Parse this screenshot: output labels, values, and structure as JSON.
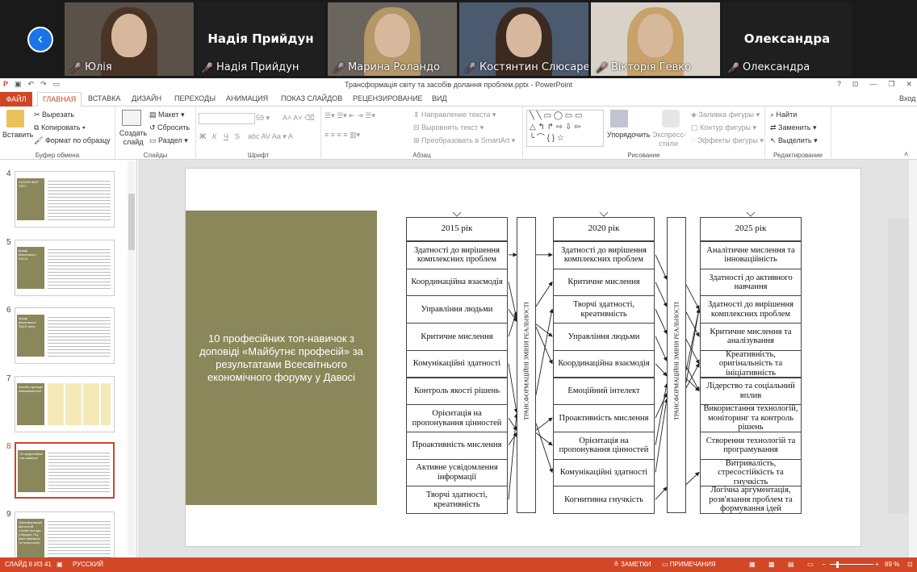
{
  "videocall": {
    "participants": [
      {
        "caption": "Юлія",
        "type": "video"
      },
      {
        "caption": "Надія Прийдун",
        "type": "name",
        "big_name": "Надія Прийдун"
      },
      {
        "caption": "Марина Роландо",
        "type": "video"
      },
      {
        "caption": "Костянтин Слюсарен...",
        "type": "video"
      },
      {
        "caption": "Вікторія Гевко",
        "type": "video"
      },
      {
        "caption": "Олександра",
        "type": "name",
        "big_name": "Олександра"
      }
    ]
  },
  "app": {
    "title": "Трансформація світу та засобів долання проблем.pptx - PowerPoint",
    "help": "?",
    "signin": "Вход"
  },
  "ribbon_tabs": [
    "ФАЙЛ",
    "ГЛАВНАЯ",
    "ВСТАВКА",
    "ДИЗАЙН",
    "ПЕРЕХОДЫ",
    "АНИМАЦИЯ",
    "ПОКАЗ СЛАЙДОВ",
    "РЕЦЕНЗИРОВАНИЕ",
    "ВИД"
  ],
  "ribbon": {
    "clipboard": {
      "paste": "Вставить",
      "cut": "Вырезать",
      "copy": "Копировать",
      "format": "Формат по образцу",
      "label": "Буфер обмена"
    },
    "slides": {
      "new": "Создать слайд",
      "layout": "Макет",
      "reset": "Сбросить",
      "section": "Раздел",
      "label": "Слайды"
    },
    "font": {
      "size": "59",
      "label": "Шрифт",
      "bold": "Ж",
      "italic": "К",
      "underline": "Ч",
      "shadow": "S"
    },
    "paragraph": {
      "direction": "Направление текста",
      "align": "Выровнять текст",
      "smartart": "Преобразовать в SmartArt",
      "label": "Абзац"
    },
    "drawing": {
      "arrange": "Упорядочить",
      "quick": "Экспресс-стили",
      "fill": "Заливка фигуры",
      "outline": "Контур фигуры",
      "effects": "Эффекты фигуры",
      "label": "Рисование"
    },
    "editing": {
      "find": "Найти",
      "replace": "Заменить",
      "select": "Выделить",
      "label": "Редактирование"
    }
  },
  "thumbnails": [
    {
      "num": "4",
      "text": "VUCA В ЖИТ ТЕРІ"
    },
    {
      "num": "5",
      "text": "Кращі властивості VUCA"
    },
    {
      "num": "6",
      "text": "Кращі властивості SAVE світу"
    },
    {
      "num": "7",
      "text": "Засоби протидії невизначеності"
    },
    {
      "num": "8",
      "text": "10 професійних топ-навичок"
    },
    {
      "num": "9",
      "text": "Трансформація цінностей: головні тренди (гібридні, ПЦ, рівні навчання та технологій)"
    }
  ],
  "slide": {
    "title": "10 професійних топ-навичок з доповіді «Майбутнє професій» за результатами Всесвітнього економічного форуму у Давосі",
    "columns": [
      {
        "header": "2015 рік",
        "items": [
          "Здатності до вирішення комплексних проблем",
          "Координаційна взаємодія",
          "Управління людьми",
          "Критичне мислення",
          "Комунікаційні здатності",
          "Контроль якості рішень",
          "Орієнтація на пропонування цінностей",
          "Проактивність мислення",
          "Активне усвідомлення інформації",
          "Творчі здатності, креативність"
        ]
      },
      {
        "header": "2020 рік",
        "items": [
          "Здатності до вирішення комплексних проблем",
          "Критичне мислення",
          "Творчі здатності, креативність",
          "Управління людьми",
          "Координаційна взаємодія",
          "Емоційний інтелект",
          "Проактивність мислення",
          "Орієнтація на пропонування цінностей",
          "Комунікаційні здатності",
          "Когнитивна гнучкість"
        ]
      },
      {
        "header": "2025 рік",
        "items": [
          "Аналітичне мислення та інноваційність",
          "Здатності до активного навчання",
          "Здатності до вирішення комплексних проблем",
          "Критичне мислення та аналізування",
          "Креативність, оригінальність та ініціативність",
          "Лідерство та соціальний вплив",
          "Використання технологій, моніторинг та контроль рішень",
          "Створення технологій та програмування",
          "Витривалість, стресостійкість та гнучкість",
          "Логічна аргументація, розв'язання проблем та формування ідей"
        ]
      }
    ],
    "vertical_label": "ТРАНСФОРМАЦІЙНІ ЗМІНИ РЕАЛЬНОСТІ",
    "arrows_1": [
      [
        0,
        0
      ],
      [
        1,
        4
      ],
      [
        2,
        3
      ],
      [
        3,
        1
      ],
      [
        4,
        8
      ],
      [
        6,
        7
      ],
      [
        7,
        6
      ],
      [
        9,
        2
      ]
    ],
    "arrows_2": [
      [
        0,
        2
      ],
      [
        1,
        3
      ],
      [
        2,
        4
      ],
      [
        3,
        5
      ],
      [
        4,
        5
      ],
      [
        6,
        4
      ],
      [
        7,
        2
      ],
      [
        8,
        2
      ],
      [
        9,
        8
      ]
    ]
  },
  "status": {
    "slide": "СЛАЙД 8 ИЗ 41",
    "lang": "РУССКИЙ",
    "notes": "ЗАМЕТКИ",
    "comments": "ПРИМЕЧАНИЯ",
    "zoom": "89 %"
  }
}
